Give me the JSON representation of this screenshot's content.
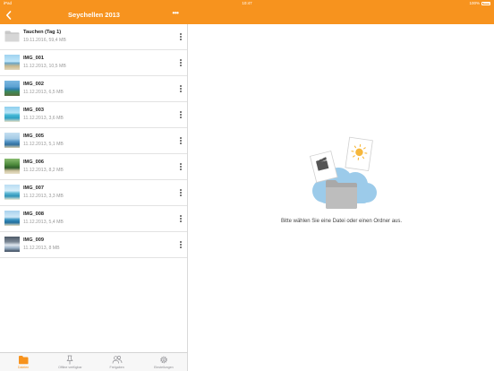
{
  "status_bar": {
    "device": "iPad",
    "time": "10:47",
    "battery": "100%"
  },
  "nav": {
    "title": "Seychellen 2013",
    "more": "•••"
  },
  "files": [
    {
      "name": "Tauchen (Tag 1)",
      "meta": "19.11.2016, 59,4 MB",
      "kind": "folder"
    },
    {
      "name": "IMG_001",
      "meta": "11.12.2013, 10,5 MB",
      "kind": "photo"
    },
    {
      "name": "IMG_002",
      "meta": "11.12.2013, 6,5 MB",
      "kind": "photo"
    },
    {
      "name": "IMG_003",
      "meta": "11.12.2013, 3,6 MB",
      "kind": "photo"
    },
    {
      "name": "IMG_005",
      "meta": "11.12.2013, 5,1 MB",
      "kind": "photo"
    },
    {
      "name": "IMG_006",
      "meta": "11.12.2013, 8,2 MB",
      "kind": "photo"
    },
    {
      "name": "IMG_007",
      "meta": "11.12.2013, 3,3 MB",
      "kind": "photo"
    },
    {
      "name": "IMG_008",
      "meta": "11.12.2013, 5,4 MB",
      "kind": "photo"
    },
    {
      "name": "IMG_009",
      "meta": "11.12.2013, 8 MB",
      "kind": "photo"
    }
  ],
  "empty_state": {
    "message": "Bitte wählen Sie eine Datei oder einen Ordner aus."
  },
  "tabs": [
    {
      "label": "Dateien",
      "icon": "folder-icon",
      "active": true
    },
    {
      "label": "Offline verfügbar",
      "icon": "pin-icon",
      "active": false
    },
    {
      "label": "Freigaben",
      "icon": "shared-users-icon",
      "active": false
    },
    {
      "label": "Einstellungen",
      "icon": "gear-icon",
      "active": false
    }
  ],
  "colors": {
    "accent": "#f7931e",
    "text_primary": "#222222",
    "text_secondary": "#9a9a9a",
    "cloud": "#8ec3e6"
  }
}
